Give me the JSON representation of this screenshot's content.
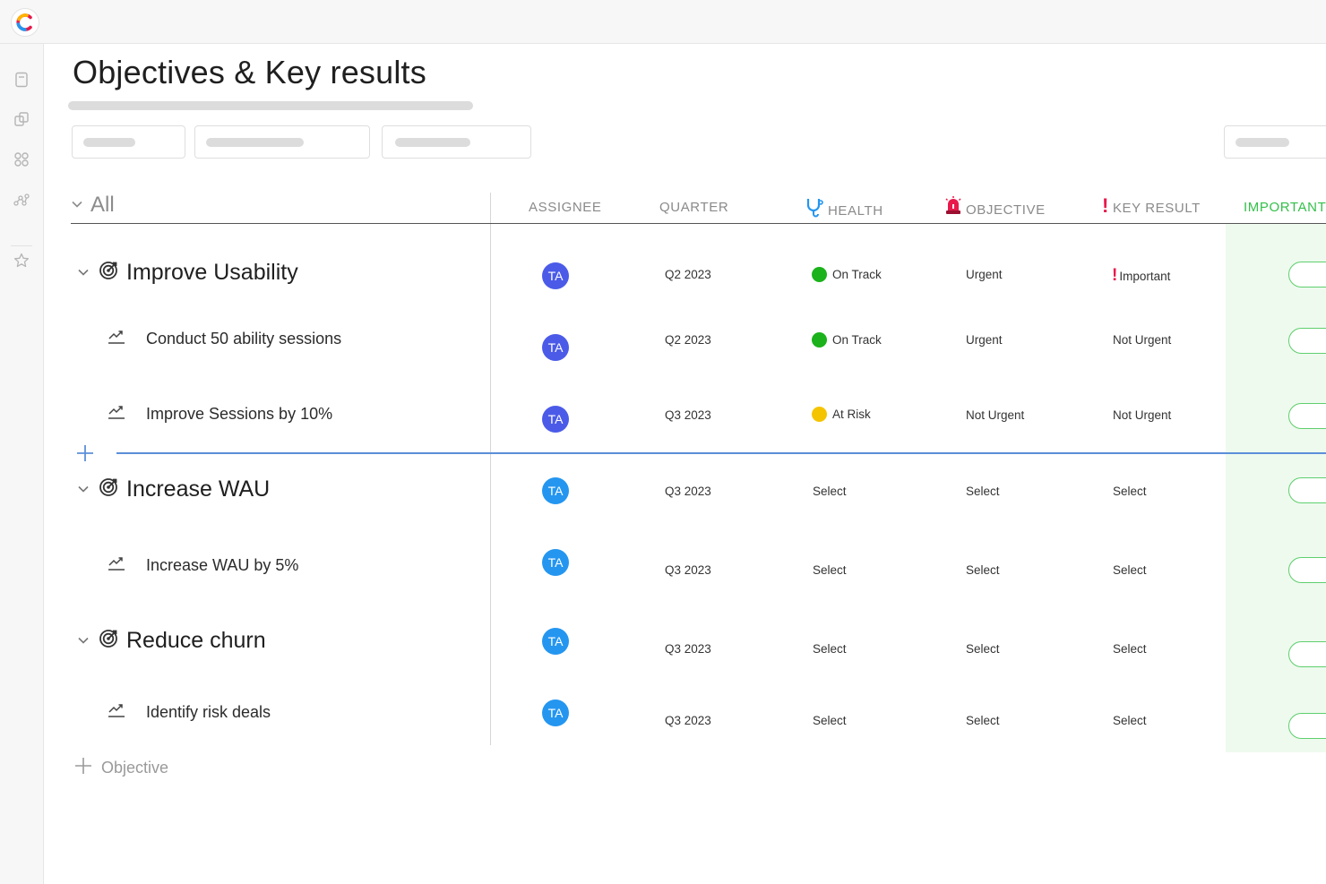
{
  "page": {
    "title": "Objectives & Key results"
  },
  "all_group": {
    "label": "All"
  },
  "columns": {
    "assignee": "ASSIGNEE",
    "quarter": "QUARTER",
    "health": "HEALTH",
    "objective": "OBJECTIVE",
    "key_result": "KEY RESULT",
    "importance": "IMPORTANT/"
  },
  "rows": [
    {
      "name": "Improve Usability",
      "type": "objective",
      "assignee": "TA",
      "quarter": "Q2 2023",
      "health": "On Track",
      "objective": "Urgent",
      "key_result": "Important",
      "key_result_flag": "!"
    },
    {
      "name": "Conduct 50 ability sessions",
      "type": "key_result",
      "assignee": "TA",
      "quarter": "Q2 2023",
      "health": "On Track",
      "objective": "Urgent",
      "key_result": "Not Urgent"
    },
    {
      "name": "Improve Sessions by 10%",
      "type": "key_result",
      "assignee": "TA",
      "quarter": "Q3 2023",
      "health": "At Risk",
      "objective": "Not Urgent",
      "key_result": "Not Urgent"
    },
    {
      "name": "Increase WAU",
      "type": "objective",
      "assignee": "TA",
      "quarter": "Q3 2023",
      "health": "Select",
      "objective": "Select",
      "key_result": "Select"
    },
    {
      "name": "Increase WAU by 5%",
      "type": "key_result",
      "assignee": "TA",
      "quarter": "Q3 2023",
      "health": "Select",
      "objective": "Select",
      "key_result": "Select"
    },
    {
      "name": "Reduce churn",
      "type": "objective",
      "assignee": "TA",
      "quarter": "Q3 2023",
      "health": "Select",
      "objective": "Select",
      "key_result": "Select"
    },
    {
      "name": "Identify risk deals",
      "type": "key_result",
      "assignee": "TA",
      "quarter": "Q3 2023",
      "health": "Select",
      "objective": "Select",
      "key_result": "Select"
    }
  ],
  "add_objective": {
    "label": "Objective"
  },
  "colors": {
    "on_track": "#1bb21b",
    "at_risk": "#f5c400",
    "avatar_dark": "#4b5be8",
    "avatar_light": "#2496f0",
    "importance_green": "#34c04a",
    "divider_blue": "#5b8fd9",
    "flag_red": "#e8194b"
  },
  "icons": {
    "logo": "app-logo",
    "sidebar": [
      "document-icon",
      "copy-icon",
      "apps-icon",
      "network-icon",
      "star-icon"
    ],
    "health": "stethoscope-icon",
    "objective": "siren-icon",
    "key_result": "exclamation-icon",
    "objective_row": "target-icon",
    "key_result_row": "trend-up-icon"
  }
}
